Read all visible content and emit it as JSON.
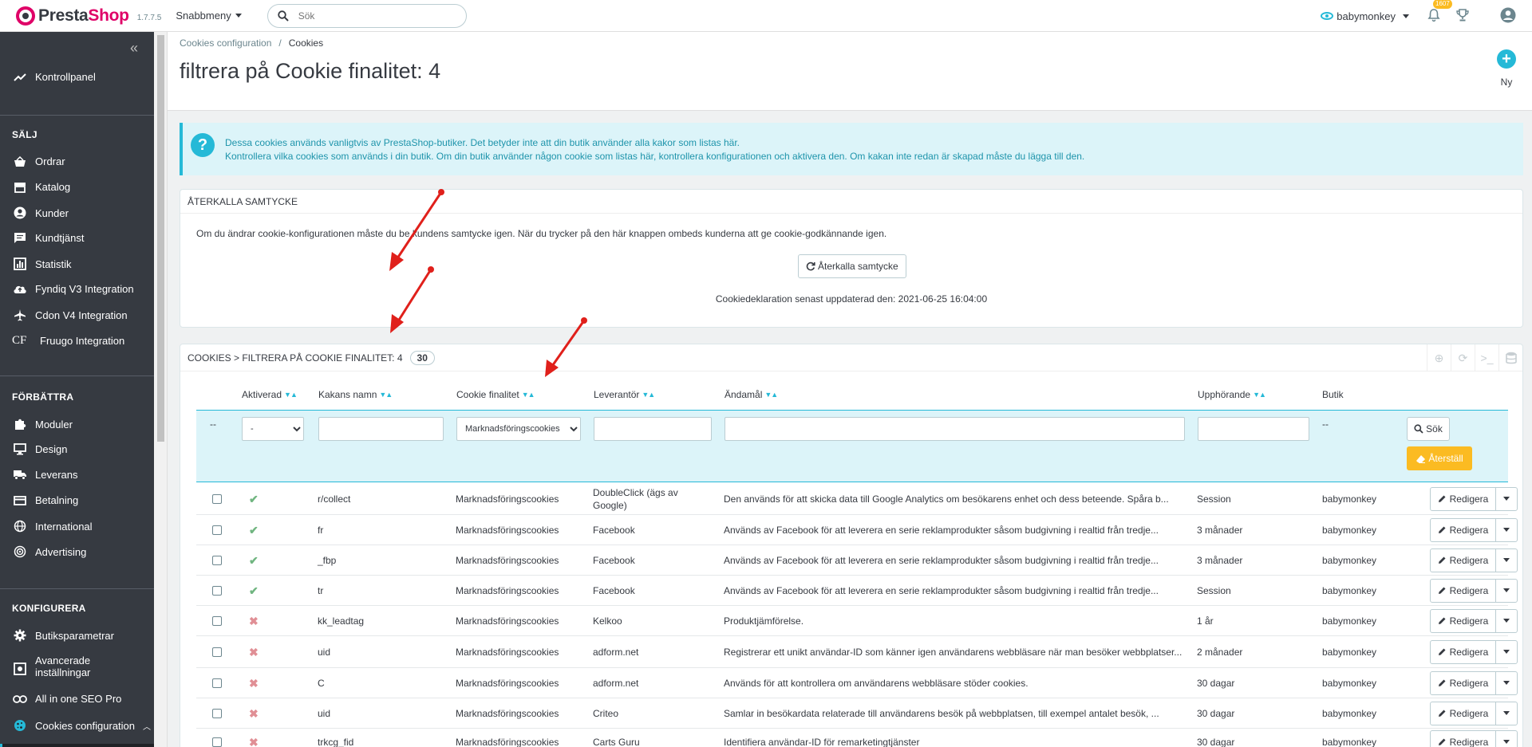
{
  "header": {
    "logo_left": "Presta",
    "logo_right": "Shop",
    "version": "1.7.7.5",
    "quick_access": "Snabbmeny",
    "search_placeholder": "Sök",
    "user": "babymonkey",
    "notifications": "1607"
  },
  "sidebar": {
    "dashboard": "Kontrollpanel",
    "section_sell": "SÄLJ",
    "sell_items": [
      "Ordrar",
      "Katalog",
      "Kunder",
      "Kundtjänst",
      "Statistik",
      "Fyndiq V3 Integration",
      "Cdon V4 Integration",
      "Fruugo Integration"
    ],
    "cf_label": "CF",
    "section_improve": "FÖRBÄTTRA",
    "improve_items": [
      "Moduler",
      "Design",
      "Leverans",
      "Betalning",
      "International",
      "Advertising"
    ],
    "section_configure": "KONFIGURERA",
    "configure_items": [
      "Butiksparametrar",
      "Avancerade inställningar",
      "All in one SEO Pro",
      "Cookies configuration"
    ]
  },
  "page": {
    "breadcrumb_parent": "Cookies configuration",
    "breadcrumb_current": "Cookies",
    "title": "filtrera på Cookie finalitet: 4",
    "new_label": "Ny"
  },
  "alert": {
    "line1": "Dessa cookies används vanligtvis av PrestaShop-butiker. Det betyder inte att din butik använder alla kakor som listas här.",
    "line2": "Kontrollera vilka cookies som används i din butik. Om din butik använder någon cookie som listas här, kontrollera konfigurationen och aktivera den. Om kakan inte redan är skapad måste du lägga till den."
  },
  "consent_panel": {
    "heading": "ÅTERKALLA SAMTYCKE",
    "description": "Om du ändrar cookie-konfigurationen måste du be kundens samtycke igen. När du trycker på den här knappen ombeds kunderna att ge cookie-godkännande igen.",
    "button": "Återkalla samtycke",
    "updated": "Cookiedeklaration senast uppdaterad den: 2021-06-25 16:04:00"
  },
  "list_panel": {
    "heading": "COOKIES > FILTRERA PÅ COOKIE FINALITET: 4",
    "count": "30",
    "columns": [
      "Aktiverad",
      "Kakans namn",
      "Cookie finalitet",
      "Leverantör",
      "Ändamål",
      "Upphörande",
      "Butik"
    ],
    "filters": {
      "lead_dash": "--",
      "active_value": "-",
      "finality_value": "Marknadsföringscookies",
      "shop_dash": "--",
      "search_button": "Sök",
      "reset_button": "Återställ"
    },
    "edit_label": "Redigera",
    "rows": [
      {
        "active": true,
        "name": "r/collect",
        "finality": "Marknadsföringscookies",
        "provider": "DoubleClick (ägs av Google)",
        "purpose": "Den används för att skicka data till Google Analytics om besökarens enhet och dess beteende. Spåra b...",
        "expiry": "Session",
        "shop": "babymonkey"
      },
      {
        "active": true,
        "name": "fr",
        "finality": "Marknadsföringscookies",
        "provider": "Facebook",
        "purpose": "Används av Facebook för att leverera en serie reklamprodukter såsom budgivning i realtid från tredje...",
        "expiry": "3 månader",
        "shop": "babymonkey"
      },
      {
        "active": true,
        "name": "_fbp",
        "finality": "Marknadsföringscookies",
        "provider": "Facebook",
        "purpose": "Används av Facebook för att leverera en serie reklamprodukter såsom budgivning i realtid från tredje...",
        "expiry": "3 månader",
        "shop": "babymonkey"
      },
      {
        "active": true,
        "name": "tr",
        "finality": "Marknadsföringscookies",
        "provider": "Facebook",
        "purpose": "Används av Facebook för att leverera en serie reklamprodukter såsom budgivning i realtid från tredje...",
        "expiry": "Session",
        "shop": "babymonkey"
      },
      {
        "active": false,
        "name": "kk_leadtag",
        "finality": "Marknadsföringscookies",
        "provider": "Kelkoo",
        "purpose": "Produktjämförelse.",
        "expiry": "1 år",
        "shop": "babymonkey"
      },
      {
        "active": false,
        "name": "uid",
        "finality": "Marknadsföringscookies",
        "provider": "adform.net",
        "purpose": "Registrerar ett unikt användar-ID som känner igen användarens webbläsare när man besöker webbplatser...",
        "expiry": "2 månader",
        "shop": "babymonkey"
      },
      {
        "active": false,
        "name": "C",
        "finality": "Marknadsföringscookies",
        "provider": "adform.net",
        "purpose": "Används för att kontrollera om användarens webbläsare stöder cookies.",
        "expiry": "30 dagar",
        "shop": "babymonkey"
      },
      {
        "active": false,
        "name": "uid",
        "finality": "Marknadsföringscookies",
        "provider": "Criteo",
        "purpose": "Samlar in besökardata relaterade till användarens besök på webbplatsen, till exempel antalet besök, ...",
        "expiry": "30 dagar",
        "shop": "babymonkey"
      },
      {
        "active": false,
        "name": "trkcg_fid",
        "finality": "Marknadsföringscookies",
        "provider": "Carts Guru",
        "purpose": "Identifiera användar-ID för remarketingtjänster",
        "expiry": "30 dagar",
        "shop": "babymonkey"
      }
    ]
  },
  "colors": {
    "accent": "#25b9d7",
    "brand": "#df0067",
    "sidebar": "#363a41",
    "warning": "#fbbb22",
    "annotation": "#e0201b"
  }
}
